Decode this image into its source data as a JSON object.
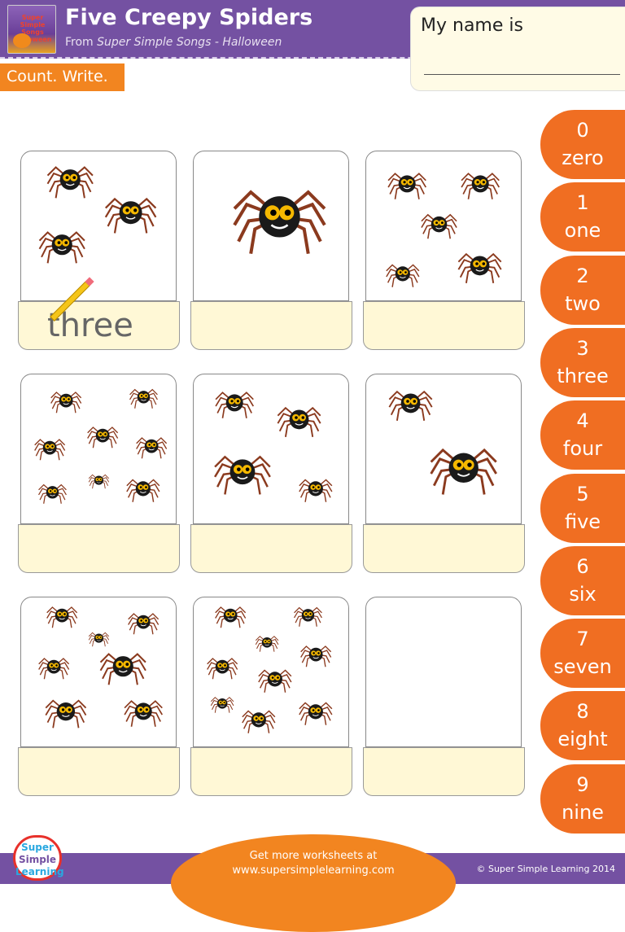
{
  "header": {
    "title": "Five Creepy Spiders",
    "subtitle_prefix": "From ",
    "subtitle_source": "Super Simple Songs - Halloween",
    "cover_text": "Super Simple Songs Halloween"
  },
  "name_box": {
    "label": "My name is",
    "value": ""
  },
  "instruction": "Count. Write.",
  "cards": [
    {
      "spider_count": 3,
      "answer": "three"
    },
    {
      "spider_count": 1,
      "answer": ""
    },
    {
      "spider_count": 5,
      "answer": ""
    },
    {
      "spider_count": 8,
      "answer": ""
    },
    {
      "spider_count": 4,
      "answer": ""
    },
    {
      "spider_count": 2,
      "answer": ""
    },
    {
      "spider_count": 7,
      "answer": ""
    },
    {
      "spider_count": 9,
      "answer": ""
    },
    {
      "spider_count": 0,
      "answer": ""
    }
  ],
  "number_tabs": [
    {
      "digit": "0",
      "word": "zero"
    },
    {
      "digit": "1",
      "word": "one"
    },
    {
      "digit": "2",
      "word": "two"
    },
    {
      "digit": "3",
      "word": "three"
    },
    {
      "digit": "4",
      "word": "four"
    },
    {
      "digit": "5",
      "word": "five"
    },
    {
      "digit": "6",
      "word": "six"
    },
    {
      "digit": "7",
      "word": "seven"
    },
    {
      "digit": "8",
      "word": "eight"
    },
    {
      "digit": "9",
      "word": "nine"
    }
  ],
  "footer": {
    "line1": "Get more worksheets at",
    "line2": "www.supersimplelearning.com",
    "copyright": "© Super Simple Learning 2014",
    "logo_text": [
      "Super",
      "Simple",
      "Learning"
    ]
  },
  "colors": {
    "purple": "#7451a2",
    "orange": "#f28520",
    "tab_orange": "#f06e22",
    "answer_bg": "#fff8d6",
    "spider_body": "#1a1a1a",
    "spider_legs": "#8b3a1e",
    "spider_eyes": "#f5b800"
  }
}
